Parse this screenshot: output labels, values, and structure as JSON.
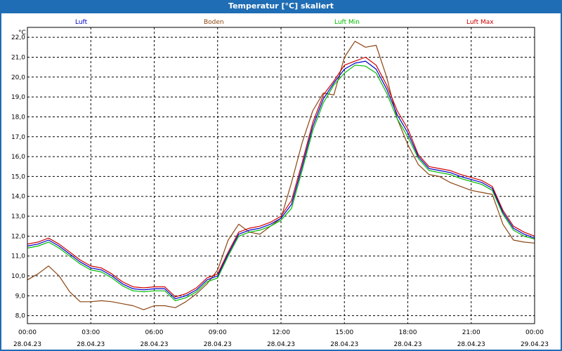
{
  "window": {
    "title": "Temperatur [°C] skaliert"
  },
  "colors": {
    "background": "#1f6db4",
    "luft": "#0000cc",
    "boden": "#8b4513",
    "luft_min": "#00bb00",
    "luft_max": "#cc0000"
  },
  "chart_data": {
    "type": "line",
    "title": "Temperatur [°C] skaliert",
    "ylabel": "°C",
    "xlabel": "",
    "ylim": [
      7.6,
      22.5
    ],
    "grid": true,
    "legend_position": "top",
    "y_ticks": [
      "8,0",
      "9,0",
      "10,0",
      "11,0",
      "12,0",
      "13,0",
      "14,0",
      "15,0",
      "16,0",
      "17,0",
      "18,0",
      "19,0",
      "20,0",
      "21,0",
      "22,0"
    ],
    "x_ticks": [
      {
        "time": "00:00",
        "date": "28.04.23"
      },
      {
        "time": "03:00",
        "date": "28.04.23"
      },
      {
        "time": "06:00",
        "date": "28.04.23"
      },
      {
        "time": "09:00",
        "date": "28.04.23"
      },
      {
        "time": "12:00",
        "date": "28.04.23"
      },
      {
        "time": "15:00",
        "date": "28.04.23"
      },
      {
        "time": "18:00",
        "date": "28.04.23"
      },
      {
        "time": "21:00",
        "date": "28.04.23"
      },
      {
        "time": "00:00",
        "date": "29.04.23"
      }
    ],
    "x": [
      "00:00",
      "00:30",
      "01:00",
      "01:30",
      "02:00",
      "02:30",
      "03:00",
      "03:30",
      "04:00",
      "04:30",
      "05:00",
      "05:30",
      "06:00",
      "06:30",
      "07:00",
      "07:30",
      "08:00",
      "08:30",
      "09:00",
      "09:30",
      "10:00",
      "10:30",
      "11:00",
      "11:30",
      "12:00",
      "12:30",
      "13:00",
      "13:30",
      "14:00",
      "14:30",
      "15:00",
      "15:30",
      "16:00",
      "16:30",
      "17:00",
      "17:30",
      "18:00",
      "18:30",
      "19:00",
      "19:30",
      "20:00",
      "20:30",
      "21:00",
      "21:30",
      "22:00",
      "22:30",
      "23:00",
      "23:30",
      "00:00"
    ],
    "series": [
      {
        "name": "Luft",
        "color": "#0000cc",
        "values": [
          11.5,
          11.6,
          11.8,
          11.5,
          11.1,
          10.7,
          10.4,
          10.3,
          10.0,
          9.6,
          9.35,
          9.3,
          9.35,
          9.35,
          8.85,
          9.0,
          9.3,
          9.8,
          10.0,
          11.1,
          12.1,
          12.3,
          12.4,
          12.6,
          12.9,
          13.6,
          15.5,
          17.5,
          18.9,
          19.7,
          20.4,
          20.7,
          20.8,
          20.4,
          19.4,
          18.1,
          17.2,
          16.0,
          15.4,
          15.3,
          15.2,
          15.0,
          14.85,
          14.7,
          14.4,
          13.2,
          12.4,
          12.1,
          11.9
        ]
      },
      {
        "name": "Boden",
        "color": "#8b4513",
        "values": [
          9.8,
          10.1,
          10.5,
          10.0,
          9.2,
          8.7,
          8.7,
          8.75,
          8.7,
          8.6,
          8.5,
          8.3,
          8.5,
          8.5,
          8.4,
          8.7,
          9.1,
          9.6,
          10.3,
          11.8,
          12.6,
          12.2,
          12.1,
          12.5,
          12.9,
          14.7,
          16.7,
          18.3,
          19.2,
          19.1,
          21.0,
          21.8,
          21.5,
          21.6,
          20.0,
          17.9,
          16.6,
          15.6,
          15.1,
          15.0,
          14.7,
          14.5,
          14.3,
          14.2,
          14.1,
          12.6,
          11.8,
          11.7,
          11.65
        ]
      },
      {
        "name": "Luft Min",
        "color": "#00bb00",
        "values": [
          11.4,
          11.5,
          11.7,
          11.4,
          11.0,
          10.6,
          10.3,
          10.2,
          9.9,
          9.5,
          9.25,
          9.2,
          9.25,
          9.25,
          8.75,
          8.9,
          9.2,
          9.7,
          9.9,
          11.0,
          12.0,
          12.2,
          12.3,
          12.5,
          12.8,
          13.4,
          15.3,
          17.3,
          18.7,
          19.6,
          20.2,
          20.6,
          20.55,
          20.2,
          19.2,
          17.9,
          17.0,
          15.9,
          15.3,
          15.2,
          15.1,
          14.9,
          14.75,
          14.6,
          14.3,
          13.1,
          12.3,
          12.0,
          11.85
        ]
      },
      {
        "name": "Luft Max",
        "color": "#cc0000",
        "values": [
          11.6,
          11.7,
          11.9,
          11.6,
          11.2,
          10.8,
          10.5,
          10.4,
          10.1,
          9.7,
          9.45,
          9.4,
          9.45,
          9.45,
          8.95,
          9.1,
          9.4,
          9.9,
          10.1,
          11.2,
          12.2,
          12.4,
          12.5,
          12.7,
          13.0,
          13.8,
          15.7,
          17.7,
          19.1,
          19.8,
          20.6,
          20.8,
          21.0,
          20.6,
          19.6,
          18.3,
          17.4,
          16.1,
          15.5,
          15.4,
          15.3,
          15.1,
          14.95,
          14.8,
          14.5,
          13.3,
          12.5,
          12.2,
          12.0
        ]
      }
    ]
  }
}
